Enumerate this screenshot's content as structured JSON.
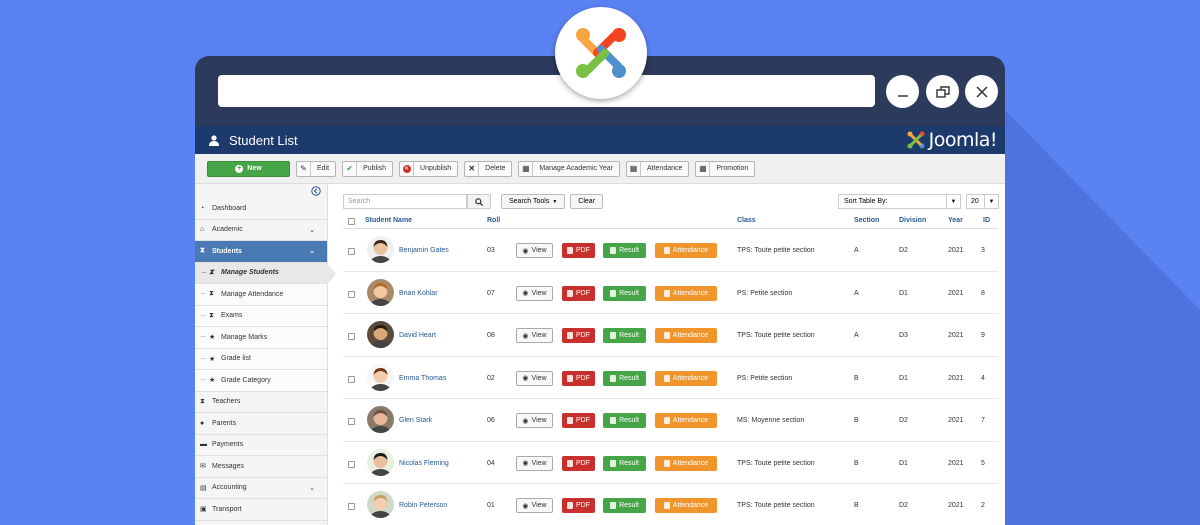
{
  "app": {
    "title": "Student List",
    "brand": "Joomla!",
    "accent": "#1c3a6b",
    "background": "#5b82f2"
  },
  "toolbar": {
    "new": "New",
    "edit": "Edit",
    "publish": "Publish",
    "unpublish": "Unpublish",
    "delete": "Delete",
    "manage_academic_year": "Manage Academic Year",
    "attendance": "Attendance",
    "promotion": "Promotion"
  },
  "sidebar": {
    "items": [
      {
        "label": "Dashboard",
        "icon": "dashboard-icon"
      },
      {
        "label": "Academic",
        "icon": "home-icon"
      },
      {
        "label": "Students",
        "icon": "graduate-icon"
      },
      {
        "label": "Manage Students",
        "icon": "graduate-icon"
      },
      {
        "label": "Manage Attendance",
        "icon": "graduate-icon"
      },
      {
        "label": "Exams",
        "icon": "graduate-icon"
      },
      {
        "label": "Manage Marks",
        "icon": "star-icon"
      },
      {
        "label": "Grade list",
        "icon": "star-icon"
      },
      {
        "label": "Grade Category",
        "icon": "star-icon"
      },
      {
        "label": "Teachers",
        "icon": "teacher-icon"
      },
      {
        "label": "Parents",
        "icon": "user-icon"
      },
      {
        "label": "Payments",
        "icon": "card-icon"
      },
      {
        "label": "Messages",
        "icon": "envelope-icon"
      },
      {
        "label": "Accounting",
        "icon": "calculator-icon"
      },
      {
        "label": "Transport",
        "icon": "bus-icon"
      }
    ]
  },
  "filters": {
    "search_placeholder": "Search",
    "search_tools": "Search Tools",
    "clear": "Clear",
    "sort": "Sort Table By:",
    "limit": "20"
  },
  "table": {
    "headers": {
      "name": "Student Name",
      "roll": "Roll",
      "class": "Class",
      "section": "Section",
      "division": "Division",
      "year": "Year",
      "id": "ID"
    },
    "buttons": {
      "view": "View",
      "pdf": "PDF",
      "result": "Result",
      "attendance": "Attendance"
    },
    "rows": [
      {
        "name": "Benjamin Gates",
        "roll": "03",
        "class": "TPS: Toute petite section",
        "section": "A",
        "division": "D2",
        "year": "2021",
        "id": "3"
      },
      {
        "name": "Brian Kohlar",
        "roll": "07",
        "class": "PS: Petite section",
        "section": "A",
        "division": "D1",
        "year": "2021",
        "id": "8"
      },
      {
        "name": "David Heart",
        "roll": "08",
        "class": "TPS: Toute petite section",
        "section": "A",
        "division": "D3",
        "year": "2021",
        "id": "9"
      },
      {
        "name": "Emma Thomas",
        "roll": "02",
        "class": "PS: Petite section",
        "section": "B",
        "division": "D1",
        "year": "2021",
        "id": "4"
      },
      {
        "name": "Glen Stark",
        "roll": "06",
        "class": "MS: Moyenne section",
        "section": "B",
        "division": "D2",
        "year": "2021",
        "id": "7"
      },
      {
        "name": "Nicolas Fleming",
        "roll": "04",
        "class": "TPS: Toute petite section",
        "section": "B",
        "division": "D1",
        "year": "2021",
        "id": "5"
      },
      {
        "name": "Robin Peterson",
        "roll": "01",
        "class": "TPS: Toute petite section",
        "section": "B",
        "division": "D2",
        "year": "2021",
        "id": "2"
      }
    ]
  }
}
